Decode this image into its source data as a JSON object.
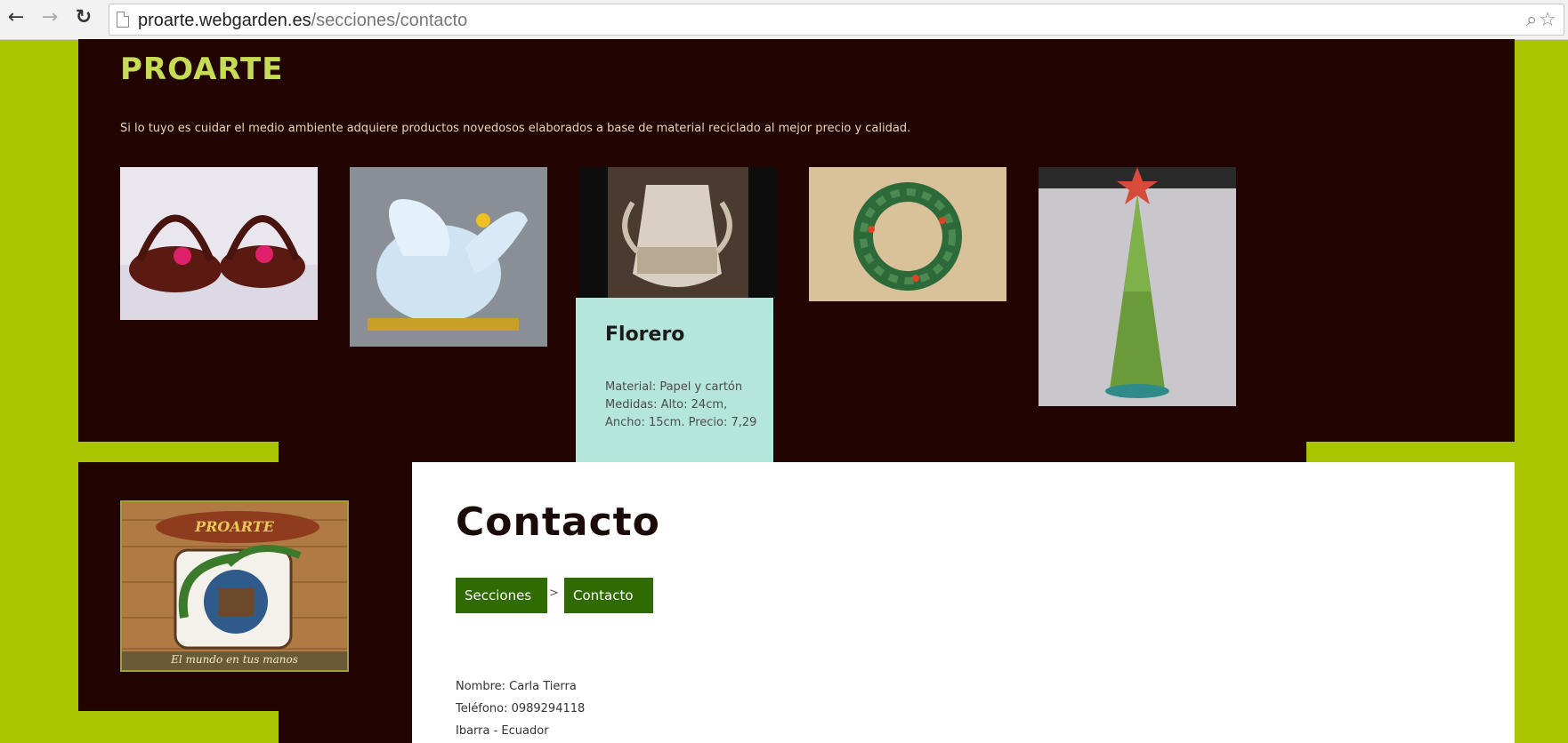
{
  "browser": {
    "url_host": "proarte.webgarden.es",
    "url_path": "/secciones/contacto"
  },
  "site": {
    "title": "PROARTE",
    "tagline": "Si lo tuyo es cuidar el medio ambiente adquiere productos novedosos elaborados a base de material reciclado al mejor precio y calidad."
  },
  "gallery": {
    "hover_card": {
      "title": "Florero",
      "description": "Material: Papel y cartón Medidas: Alto: 24cm, Ancho: 15cm. Precio: 7,29"
    }
  },
  "logo": {
    "brand_text": "PROARTE",
    "slogan": "El mundo en tus manos"
  },
  "page": {
    "title": "Contacto",
    "breadcrumb": [
      "Secciones",
      "Contacto"
    ],
    "breadcrumb_separator": ">"
  },
  "contact": {
    "name": "Nombre: Carla Tierra",
    "phone": "Teléfono: 0989294118",
    "location": "Ibarra - Ecuador"
  },
  "colors": {
    "lime": "#a9c400",
    "dark": "#220402",
    "title_green": "#c6dc55",
    "card": "#b5e6dc",
    "crumb": "#2f6b00"
  }
}
